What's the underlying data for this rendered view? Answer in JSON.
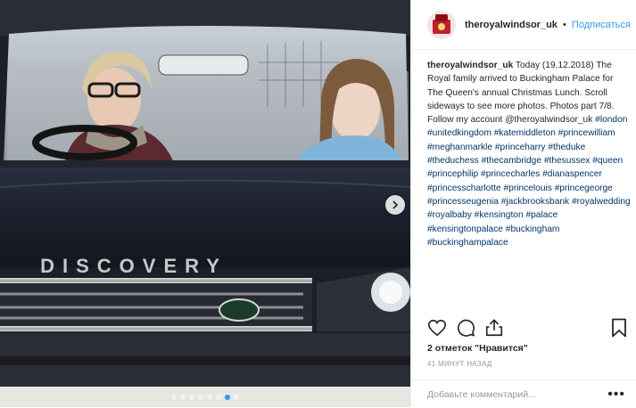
{
  "header": {
    "username": "theroyalwindsor_uk",
    "separator": "•",
    "follow_label": "Подписаться"
  },
  "caption": {
    "username": "theroyalwindsor_uk",
    "text": " Today (19.12.2018) The Royal family arrived to Buckingham Palace for The Queen's annual Christmas Lunch. Scroll sideways to see more photos. Photos part 7/8. Follow my account @theroyalwindsor_uk",
    "hashtags": "#london #unitedkingdom #katemiddleton #princewilliam #meghanmarkle #princeharry #theduke #theduchess #thecambridge #thesussex #queen #princephilip #princecharles #dianaspencer #princesscharlotte #princelouis #princegeorge #princesseugenia #jackbrooksbank #royalwedding #royalbaby #kensington #palace #kensingtonpalace #buckingham #buckinghampalace"
  },
  "photo": {
    "car_badge_text": "DISCOVERY",
    "slide_count": 8,
    "active_slide": 7
  },
  "stats": {
    "likes_text": "2 отметок \"Нравится\"",
    "time_text": "41 МИНУТ НАЗАД"
  },
  "comment": {
    "placeholder": "Добавьте комментарий...",
    "more_symbol": "•••"
  },
  "colors": {
    "accent": "#3897f0",
    "hashtag": "#003569",
    "muted": "#999999"
  },
  "icons": [
    "heart-icon",
    "comment-icon",
    "share-icon",
    "bookmark-icon",
    "chevron-right-icon",
    "more-options-icon"
  ]
}
